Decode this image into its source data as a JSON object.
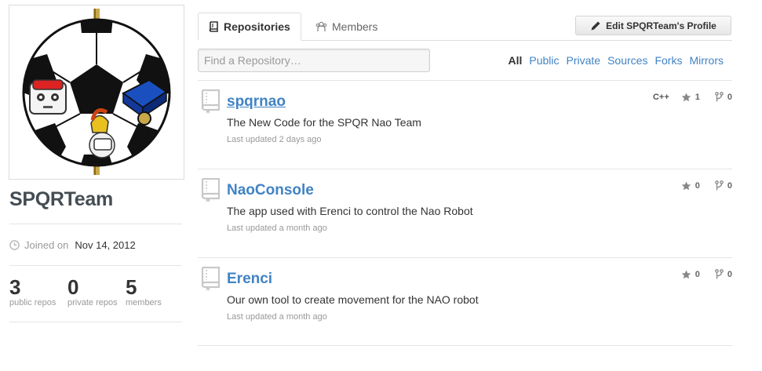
{
  "org": {
    "name": "SPQRTeam",
    "joined_label": "Joined on",
    "joined_date": "Nov 14, 2012",
    "stats": [
      {
        "value": "3",
        "label": "public repos"
      },
      {
        "value": "0",
        "label": "private repos"
      },
      {
        "value": "5",
        "label": "members"
      }
    ]
  },
  "tabs": {
    "repositories": "Repositories",
    "members": "Members"
  },
  "edit_button": "Edit SPQRTeam's Profile",
  "search": {
    "placeholder": "Find a Repository…",
    "value": ""
  },
  "filters": [
    "All",
    "Public",
    "Private",
    "Sources",
    "Forks",
    "Mirrors"
  ],
  "active_filter": "All",
  "repos": [
    {
      "name": "spqrnao",
      "description": "The New Code for the SPQR Nao Team",
      "updated": "Last updated 2 days ago",
      "language": "C++",
      "stars": "1",
      "forks": "0"
    },
    {
      "name": "NaoConsole",
      "description": "The app used with Erenci to control the Nao Robot",
      "updated": "Last updated a month ago",
      "language": "",
      "stars": "0",
      "forks": "0"
    },
    {
      "name": "Erenci",
      "description": "Our own tool to create movement for the NAO robot",
      "updated": "Last updated a month ago",
      "language": "",
      "stars": "0",
      "forks": "0"
    }
  ],
  "colors": {
    "link": "#4183c4",
    "text": "#333333",
    "muted": "#999999"
  },
  "icons": [
    "book-icon",
    "members-icon",
    "pencil-icon",
    "clock-icon",
    "star-icon",
    "fork-icon"
  ]
}
